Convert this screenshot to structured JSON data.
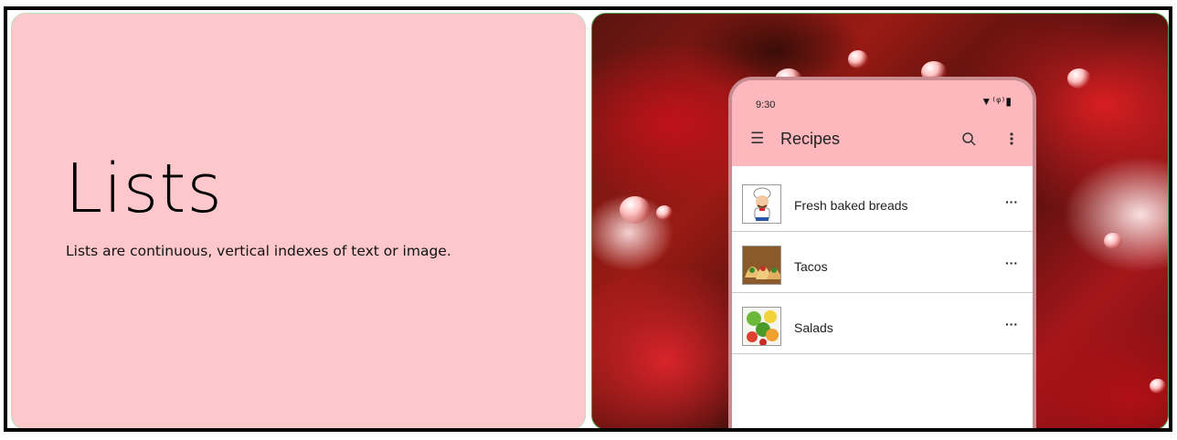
{
  "hero": {
    "title": "Lists",
    "subtitle": "Lists are continuous, vertical indexes of text or image."
  },
  "phone": {
    "status_time": "9:30",
    "status_icons": [
      "wifi-icon",
      "signal-icon",
      "battery-icon"
    ],
    "app_title": "Recipes",
    "icons": [
      "menu-icon",
      "search-icon",
      "more-vert-icon"
    ],
    "list": [
      {
        "label": "Fresh baked breads",
        "thumb": "chef-icon",
        "more": "···"
      },
      {
        "label": "Tacos",
        "thumb": "tacos-photo",
        "more": "···"
      },
      {
        "label": "Salads",
        "thumb": "salad-photo",
        "more": "···"
      }
    ]
  },
  "colors": {
    "hero_bg": "#fdc8cc",
    "appbar_bg": "#fcb8bc",
    "phone_frame": "#c98a90"
  }
}
